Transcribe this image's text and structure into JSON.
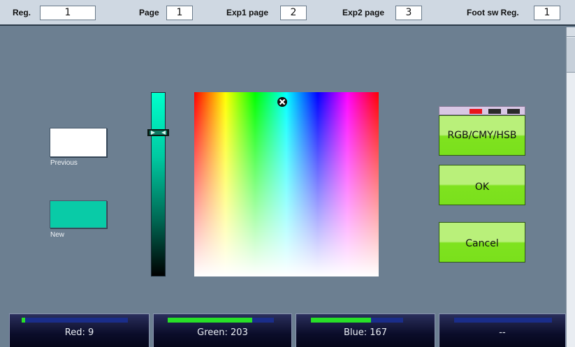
{
  "header": {
    "reg_label": "Reg.",
    "reg_value": "1",
    "page_label": "Page",
    "page_value": "1",
    "exp1_label": "Exp1 page",
    "exp1_value": "2",
    "exp2_label": "Exp2 page",
    "exp2_value": "3",
    "footsw_label": "Foot sw Reg.",
    "footsw_value": "1"
  },
  "swatches": {
    "previous_label": "Previous",
    "previous_color": "#ffffff",
    "new_label": "New",
    "new_color": "#09cba7"
  },
  "picker": {
    "brightness_level": 0.8
  },
  "buttons": {
    "mode_label": "RGB/CMY/HSB",
    "ok_label": "OK",
    "cancel_label": "Cancel"
  },
  "mode_indicators": {
    "active_color": "#e8141c",
    "inactive_color": "#2a2a2a"
  },
  "channels": [
    {
      "label": "Red: 9",
      "value": 9
    },
    {
      "label": "Green: 203",
      "value": 203
    },
    {
      "label": "Blue: 167",
      "value": 167
    },
    {
      "label": "--",
      "value": 0
    }
  ]
}
